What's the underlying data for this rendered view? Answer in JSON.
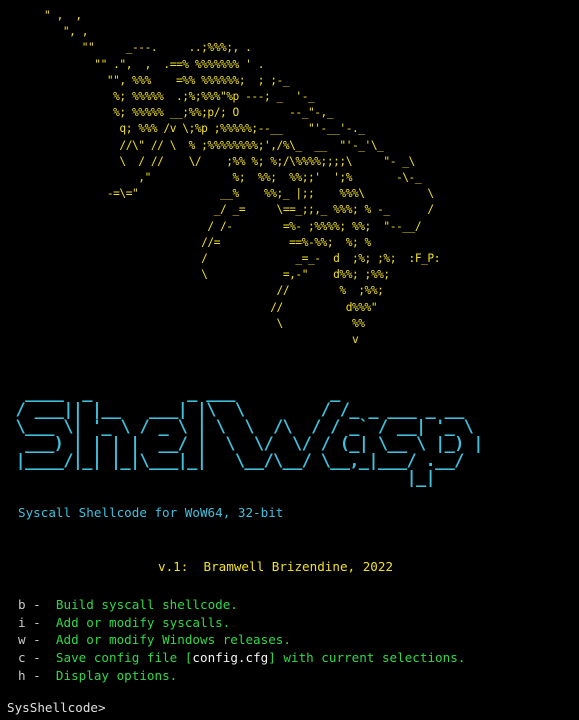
{
  "colors": {
    "background": "#000000",
    "wasp_art": "#f2e021",
    "logo": "#3fc0dc",
    "subtitle": "#3fc0dc",
    "version": "#f2e021",
    "menu_key": "#c8c8c8",
    "menu_label": "#2fd84a",
    "prompt": "#e0e0e0"
  },
  "wasp_art": "       \" ,  ,\n          \", ,\n             \"\"     _---.     ..;%%%;, .\n               \"\" .\",  ,  .==% %%%%%%% ' .\n                 \"\", %%%    =%% %%%%%%;  ; ;-_\n                  %; %%%%%  .;%;%%%\"%p ---; _  '-_\n                  %; %%%%% __;%%;p/; O        --_\"-,_\n                   q; %%% /v \\;%p ;%%%%%;--__    \"'-__'-._\n                   //\\\" // \\  % ;%%%%%%%%;',/%\\_  __  \"'-_'\\_\n                   \\  / //    \\/    ;%% %; %;/\\%%%%;;;;\\     \"- _\\\n                      ,\"             %;  %%;  %%;;'  ';%       -\\-_\n                 -=\\=\"             __%    %%;_ |;;    %%%\\          \\\n                                  _/ _=     \\==_;;,_ %%%; % -_      /\n                                 / /-        =%- ;%%%%; %%;  \"--__/\n                                //=           ==%-%%;  %; %\n                                /              _=_-  d  ;%; ;%;  :F_P:\n                                \\            =,-\"    d%%; ;%%;\n                                            //        %  ;%%;\n                                           //          d%%%\"\n                                            \\           %%\n                                                        v",
  "logo_art": "  ____  _          _ ___          _\n / ___|| |__   ___| |\\  \\        / /_ _ ___ _ __\n \\___ \\| '_ \\ / _ \\ | \\  \\  /\\  / / _` / __| '_ \\\n  ___) | | | |  __/ |  \\  \\/  \\/ / (_| \\__ \\ |_) |\n |____/|_| |_|\\___|_|   \\__/\\__/ \\__,_|___/ .__/\n                                          |_|",
  "subtitle": "Syscall Shellcode for WoW64, 32-bit",
  "version": "v.1:  Bramwell Brizendine, 2022",
  "menu": {
    "items": [
      {
        "key": "b -  ",
        "label": "Build syscall shellcode."
      },
      {
        "key": "i -  ",
        "label": "Add or modify syscalls."
      },
      {
        "key": "w -  ",
        "label": "Add or modify Windows releases."
      },
      {
        "key": "c -  ",
        "label_before": "Save config file [",
        "file": "config.cfg",
        "label_after": "] with current selections."
      },
      {
        "key": "h -  ",
        "label": "Display options."
      }
    ]
  },
  "prompt": "SysShellcode>"
}
